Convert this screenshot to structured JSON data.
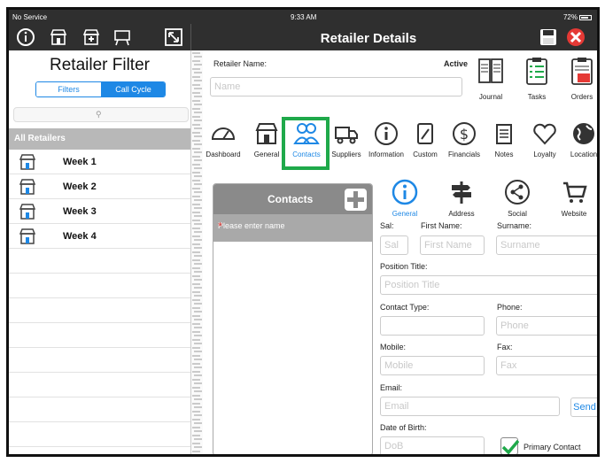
{
  "status": {
    "carrier": "No Service",
    "time": "9:33 AM",
    "battery": "72%"
  },
  "toolbar": {
    "title": "Retailer Details"
  },
  "left": {
    "title": "Retailer Filter",
    "filters_tab": "Filters",
    "callcycle_tab": "Call Cycle",
    "all_label": "All Retailers",
    "weeks": [
      "Week 1",
      "Week 2",
      "Week 3",
      "Week 4"
    ]
  },
  "main": {
    "retailer_name_label": "Retailer Name:",
    "active_label": "Active",
    "name_placeholder": "Name",
    "journal": "Journal",
    "tasks": "Tasks",
    "orders": "Orders",
    "tabs": [
      "Dashboard",
      "General",
      "Contacts",
      "Suppliers",
      "Information",
      "Custom",
      "Financials",
      "Notes",
      "Loyalty",
      "Location"
    ],
    "selected_tab": "Contacts"
  },
  "contacts": {
    "title": "Contacts",
    "placeholder": "Please enter name"
  },
  "subtabs": [
    "General",
    "Address",
    "Social",
    "Website"
  ],
  "form": {
    "sal_label": "Sal:",
    "sal_ph": "Sal",
    "first_label": "First Name:",
    "first_ph": "First Name",
    "surname_label": "Surname:",
    "surname_ph": "Surname",
    "position_label": "Position Title:",
    "position_ph": "Position Title",
    "contacttype_label": "Contact Type:",
    "phone_label": "Phone:",
    "phone_ph": "Phone",
    "mobile_label": "Mobile:",
    "mobile_ph": "Mobile",
    "fax_label": "Fax:",
    "fax_ph": "Fax",
    "email_label": "Email:",
    "email_ph": "Email",
    "send": "Send",
    "dob_label": "Date of Birth:",
    "dob_ph": "DoB",
    "primary_label": "Primary Contact"
  },
  "colors": {
    "accent": "#1e88e5",
    "highlight": "#1fa94a",
    "toolbar": "#2f2f2f",
    "cancel": "#e53935"
  }
}
